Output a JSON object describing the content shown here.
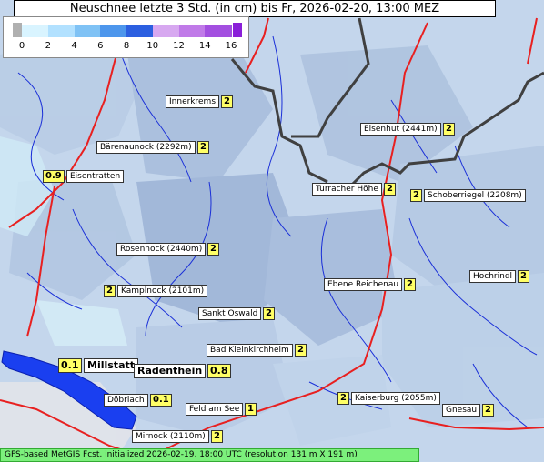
{
  "title": "Neuschnee letzte 3 Std. (in cm) bis Fr, 2026-02-20, 13:00 MEZ",
  "legend": {
    "ticks": [
      "0",
      "2",
      "4",
      "6",
      "8",
      "10",
      "12",
      "14",
      "16"
    ],
    "colors": [
      "#b0b0b0",
      "#d9f4ff",
      "#b2e1ff",
      "#7fc2f5",
      "#4d96ec",
      "#2c5fe0",
      "#d7a8f0",
      "#c07ae8",
      "#a34fe0",
      "#8a1fd8"
    ]
  },
  "places": [
    {
      "name": "Innerkrems",
      "value": "2"
    },
    {
      "name": "Eisenhut (2441m)",
      "value": "2"
    },
    {
      "name": "Bärenaunock (2292m)",
      "value": "2"
    },
    {
      "name": "Eisentratten",
      "value": "0.9"
    },
    {
      "name": "Turracher Höhe",
      "value": "2"
    },
    {
      "name": "Schoberriegel (2208m)",
      "value": "2"
    },
    {
      "name": "Rosennock (2440m)",
      "value": "2"
    },
    {
      "name": "Hochrindl",
      "value": "2"
    },
    {
      "name": "Kamplnock (2101m)",
      "value": "2"
    },
    {
      "name": "Ebene Reichenau",
      "value": "2"
    },
    {
      "name": "Sankt Oswald",
      "value": "2"
    },
    {
      "name": "Bad Kleinkirchheim",
      "value": "2"
    },
    {
      "name": "Millstatt",
      "value": "0.1"
    },
    {
      "name": "Radenthein",
      "value": "0.8"
    },
    {
      "name": "Döbriach",
      "value": "0.1"
    },
    {
      "name": "Feld am See",
      "value": "1"
    },
    {
      "name": "Kaiserburg (2055m)",
      "value": "2"
    },
    {
      "name": "Gnesau",
      "value": "2"
    },
    {
      "name": "Mirnock (2110m)",
      "value": "2"
    }
  ],
  "footer": "GFS-based MetGIS Fcst, initialized 2026-02-19, 18:00 UTC  (resolution 131 m X 191 m)"
}
